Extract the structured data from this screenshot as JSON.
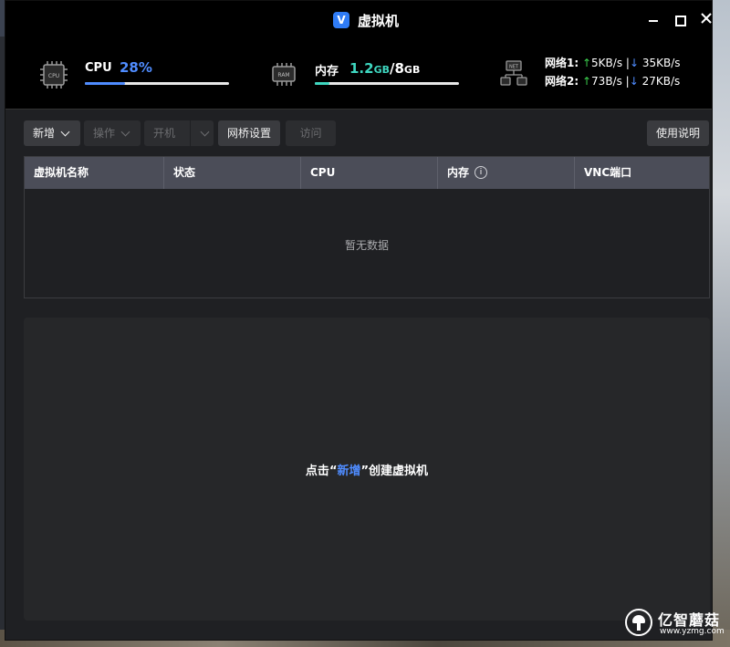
{
  "window": {
    "title": "虚拟机",
    "app_icon_letter": "V"
  },
  "stats": {
    "cpu": {
      "icon": "cpu-chip-icon",
      "chip_text": "CPU",
      "label": "CPU",
      "value": "28%",
      "usage_fraction": 0.28,
      "color": "#4f8cff"
    },
    "mem": {
      "icon": "ram-chip-icon",
      "chip_text": "RAM",
      "label": "内存",
      "used": "1.2",
      "used_unit": "GB",
      "separator": "/",
      "total": "8",
      "total_unit": "GB",
      "usage_fraction": 0.1,
      "color": "#3ed7c0"
    },
    "net": {
      "icon": "network-icon",
      "chip_text": "NET",
      "rows": [
        {
          "label": "网络1:",
          "up": "5KB/s",
          "sep": "|",
          "down": "35KB/s"
        },
        {
          "label": "网络2:",
          "up": "73B/s",
          "sep": "|",
          "down": "27KB/s"
        }
      ]
    }
  },
  "toolbar": {
    "add": "新增",
    "operate": "操作",
    "power": "开机",
    "bridge": "网桥设置",
    "visit": "访问",
    "help": "使用说明"
  },
  "table": {
    "columns": [
      "虚拟机名称",
      "状态",
      "CPU",
      "内存",
      "VNC端口"
    ],
    "empty_text": "暂无数据"
  },
  "create_prompt": {
    "before": "点击",
    "quote_open": "“",
    "link": "新增",
    "quote_close": "”",
    "after": "创建虚拟机"
  },
  "watermark": {
    "title": "亿智蘑菇",
    "url": "www.yzmg.com"
  },
  "colors": {
    "accent": "#4f8cff",
    "up_arrow": "#3ccf4e",
    "down_arrow": "#4f8cff",
    "header_bg": "#4b4d58"
  }
}
